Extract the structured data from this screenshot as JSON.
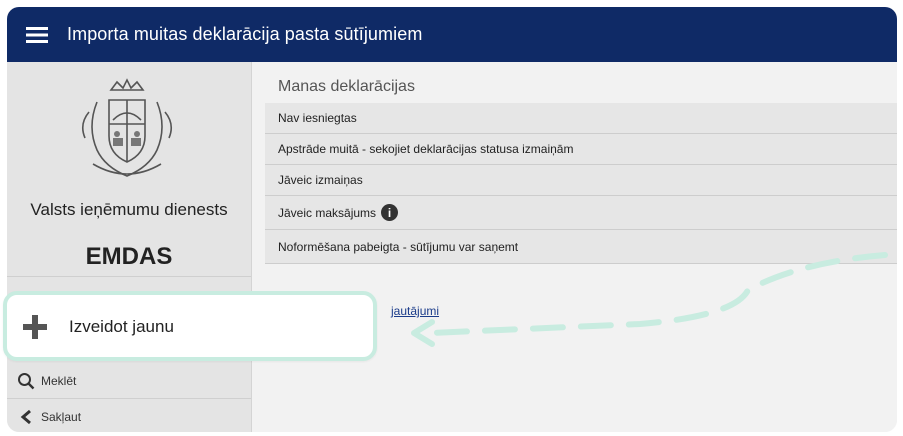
{
  "header": {
    "title": "Importa muitas deklarācija pasta sūtījumiem",
    "menu_icon": "hamburger-menu-icon"
  },
  "sidebar": {
    "org_name": "Valsts ieņēmumu dienests",
    "app_name": "EMDAS",
    "items": [
      {
        "label": "Meklēt",
        "icon": "search-icon"
      },
      {
        "label": "Sakļaut",
        "icon": "chevron-left-icon"
      }
    ]
  },
  "main": {
    "section_title": "Manas deklarācijas",
    "menu": [
      {
        "label": "Nav iesniegtas"
      },
      {
        "label": "Apstrāde muitā - sekojiet deklarācijas statusa izmaiņām"
      },
      {
        "label": "Jāveic izmaiņas"
      },
      {
        "label": "Jāveic maksājums",
        "icon": "info-icon"
      },
      {
        "label": "Noformēšana pabeigta - sūtījumu var saņemt"
      }
    ],
    "faq_link": "jautājumi"
  },
  "callout": {
    "label": "Izveidot jaunu",
    "icon": "plus-icon"
  },
  "colors": {
    "header_bg": "#0f2a66",
    "callout_border": "#c8ece0",
    "arrow": "#c8ece0"
  }
}
